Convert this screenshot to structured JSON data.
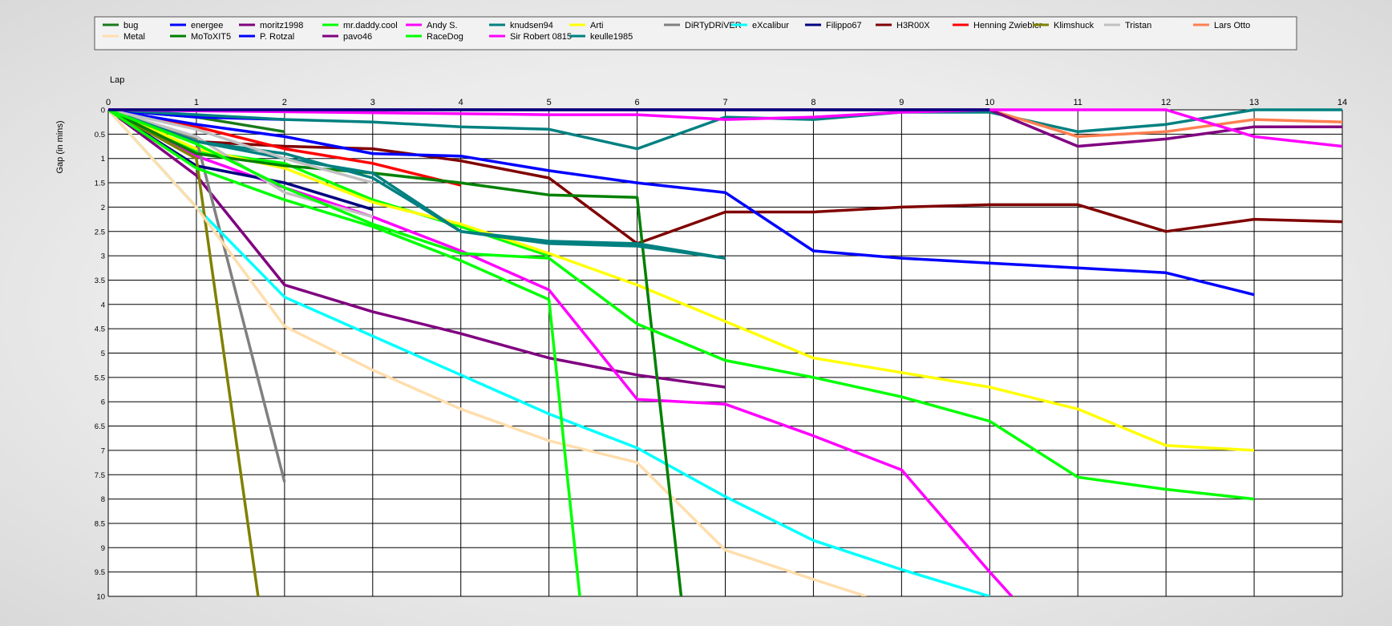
{
  "chart_data": {
    "type": "line",
    "xlabel": "Lap",
    "ylabel": "Gap (in mins)",
    "xlim": [
      0,
      14
    ],
    "ylim": [
      0,
      10
    ],
    "y_inverted": true,
    "grid": true,
    "legend_position": "top",
    "x_ticks": [
      "0",
      "1",
      "2",
      "3",
      "4",
      "5",
      "6",
      "7",
      "8",
      "9",
      "10",
      "11",
      "12",
      "13",
      "14"
    ],
    "y_ticks": [
      "0",
      "0.5",
      "1",
      "1.5",
      "2",
      "2.5",
      "3",
      "3.5",
      "4",
      "4.5",
      "5",
      "5.5",
      "6",
      "6.5",
      "7",
      "7.5",
      "8",
      "8.5",
      "9",
      "9.5",
      "10"
    ],
    "series": [
      {
        "name": "bug",
        "color": "#1a7a1a",
        "points": [
          [
            0,
            0
          ],
          [
            1,
            0.15
          ],
          [
            2,
            0.45
          ]
        ]
      },
      {
        "name": "energee",
        "color": "#0000ff",
        "points": [
          [
            0,
            0
          ],
          [
            1,
            0.15
          ],
          [
            2,
            0.2
          ]
        ]
      },
      {
        "name": "moritz1998",
        "color": "#800080",
        "points": [
          [
            0,
            0
          ],
          [
            1,
            1.35
          ],
          [
            2,
            3.6
          ],
          [
            3,
            4.15
          ],
          [
            4,
            4.6
          ],
          [
            5,
            5.1
          ],
          [
            6,
            5.45
          ],
          [
            7,
            5.7
          ]
        ]
      },
      {
        "name": "mr.daddy.cool",
        "color": "#00ff00",
        "points": [
          [
            0,
            0
          ],
          [
            1,
            0.85
          ],
          [
            2,
            1.1
          ],
          [
            3,
            1.85
          ],
          [
            4,
            2.4
          ],
          [
            5,
            3.0
          ]
        ]
      },
      {
        "name": "Andy S.",
        "color": "#ff00ff",
        "points": [
          [
            0,
            0
          ],
          [
            1,
            0.95
          ],
          [
            2,
            1.6
          ],
          [
            3,
            2.2
          ],
          [
            4,
            2.9
          ],
          [
            5,
            3.7
          ],
          [
            6,
            5.95
          ],
          [
            7,
            6.05
          ],
          [
            8,
            6.7
          ],
          [
            9,
            7.4
          ],
          [
            10,
            9.5
          ],
          [
            10.25,
            10
          ]
        ]
      },
      {
        "name": "knudsen94",
        "color": "#008080",
        "points": [
          [
            0,
            0
          ],
          [
            1,
            0.1
          ],
          [
            2,
            0.2
          ],
          [
            3,
            0.25
          ],
          [
            4,
            0.35
          ],
          [
            5,
            0.4
          ],
          [
            6,
            0.8
          ],
          [
            7,
            0.15
          ],
          [
            8,
            0.2
          ],
          [
            9,
            0.05
          ],
          [
            10,
            0.05
          ],
          [
            11,
            0.45
          ],
          [
            12,
            0.3
          ],
          [
            13,
            0.0
          ],
          [
            14,
            0.0
          ]
        ]
      },
      {
        "name": "Arti",
        "color": "#ffff00",
        "points": [
          [
            0,
            0
          ],
          [
            1,
            0.8
          ],
          [
            2,
            1.2
          ],
          [
            3,
            1.9
          ],
          [
            4,
            2.35
          ],
          [
            5,
            2.95
          ],
          [
            6,
            3.6
          ],
          [
            7,
            4.35
          ],
          [
            8,
            5.1
          ],
          [
            9,
            5.4
          ],
          [
            10,
            5.7
          ],
          [
            11,
            6.15
          ],
          [
            12,
            6.9
          ],
          [
            13,
            7.0
          ]
        ]
      },
      {
        "name": "DiRTyDRiVER",
        "color": "#808080",
        "points": [
          [
            0,
            0
          ],
          [
            1,
            0.6
          ],
          [
            2,
            7.65
          ]
        ]
      },
      {
        "name": "eXcalibur",
        "color": "#00ffff",
        "points": [
          [
            0,
            0
          ],
          [
            1,
            2.0
          ],
          [
            2,
            3.85
          ],
          [
            3,
            4.65
          ],
          [
            4,
            5.45
          ],
          [
            5,
            6.25
          ],
          [
            6,
            6.95
          ],
          [
            7,
            7.95
          ],
          [
            8,
            8.85
          ],
          [
            9,
            9.45
          ],
          [
            10,
            10
          ]
        ]
      },
      {
        "name": "Filippo67",
        "color": "#000080",
        "points": [
          [
            0,
            0
          ],
          [
            1,
            1.15
          ],
          [
            2,
            1.5
          ],
          [
            3,
            2.05
          ]
        ]
      },
      {
        "name": "H3R00X",
        "color": "#800000",
        "points": [
          [
            0,
            0
          ],
          [
            1,
            0.65
          ],
          [
            2,
            0.75
          ],
          [
            3,
            0.8
          ],
          [
            4,
            1.05
          ],
          [
            5,
            1.4
          ],
          [
            6,
            2.75
          ],
          [
            7,
            2.1
          ],
          [
            8,
            2.1
          ],
          [
            9,
            2.0
          ],
          [
            10,
            1.95
          ],
          [
            11,
            1.95
          ],
          [
            12,
            2.5
          ],
          [
            13,
            2.25
          ],
          [
            14,
            2.3
          ]
        ]
      },
      {
        "name": "Henning Zwiebler",
        "color": "#ff0000",
        "points": [
          [
            0,
            0
          ],
          [
            1,
            0.35
          ],
          [
            2,
            0.8
          ],
          [
            3,
            1.1
          ],
          [
            4,
            1.55
          ]
        ]
      },
      {
        "name": "Klimshuck",
        "color": "#808000",
        "points": [
          [
            0,
            0
          ],
          [
            1,
            1.0
          ],
          [
            1.7,
            10
          ]
        ]
      },
      {
        "name": "Tristan",
        "color": "#c0c0c0",
        "points": [
          [
            0,
            0
          ],
          [
            1,
            0.55
          ],
          [
            2,
            1.7
          ],
          [
            3,
            2.2
          ]
        ]
      },
      {
        "name": "Lars Otto",
        "color": "#ff7f50",
        "points": [
          [
            0,
            0
          ],
          [
            10,
            0.0
          ],
          [
            11,
            0.55
          ],
          [
            12,
            0.45
          ],
          [
            13,
            0.2
          ],
          [
            14,
            0.25
          ]
        ]
      },
      {
        "name": "Metal",
        "color": "#ffdead",
        "points": [
          [
            0,
            0
          ],
          [
            1,
            2.0
          ],
          [
            2,
            4.45
          ],
          [
            3,
            5.35
          ],
          [
            4,
            6.15
          ],
          [
            5,
            6.8
          ],
          [
            6,
            7.25
          ],
          [
            7,
            9.05
          ],
          [
            8,
            9.65
          ],
          [
            8.6,
            10
          ]
        ]
      },
      {
        "name": "MoToXIT5",
        "color": "#008000",
        "points": [
          [
            0,
            0
          ],
          [
            1,
            0.9
          ],
          [
            2,
            1.15
          ],
          [
            3,
            1.3
          ],
          [
            4,
            1.5
          ],
          [
            5,
            1.75
          ],
          [
            6,
            1.8
          ],
          [
            6.5,
            10
          ]
        ]
      },
      {
        "name": "P. Rotzal",
        "color": "#0000ff",
        "points": [
          [
            0,
            0
          ],
          [
            1,
            0.3
          ],
          [
            2,
            0.55
          ],
          [
            3,
            0.9
          ],
          [
            4,
            0.95
          ],
          [
            5,
            1.25
          ],
          [
            6,
            1.5
          ],
          [
            7,
            1.7
          ],
          [
            8,
            2.9
          ],
          [
            9,
            3.05
          ],
          [
            10,
            3.15
          ],
          [
            11,
            3.25
          ],
          [
            12,
            3.35
          ],
          [
            13,
            3.8
          ]
        ]
      },
      {
        "name": "pavo46",
        "color": "#800080",
        "points": [
          [
            0,
            0
          ],
          [
            10,
            0.0
          ],
          [
            11,
            0.75
          ],
          [
            12,
            0.6
          ],
          [
            13,
            0.35
          ],
          [
            14,
            0.35
          ]
        ]
      },
      {
        "name": "RaceDog",
        "color": "#00ff00",
        "points": [
          [
            0,
            0
          ],
          [
            1,
            1.2
          ],
          [
            2,
            1.85
          ],
          [
            3,
            2.4
          ],
          [
            4,
            3.1
          ],
          [
            5,
            3.9
          ],
          [
            5.35,
            10
          ]
        ]
      },
      {
        "name": "Sir Robert 0815",
        "color": "#ff00ff",
        "points": [
          [
            0,
            0
          ],
          [
            5,
            0.1
          ],
          [
            6,
            0.1
          ],
          [
            7,
            0.2
          ],
          [
            8,
            0.15
          ],
          [
            9,
            0.05
          ],
          [
            10,
            0.0
          ],
          [
            11,
            0.0
          ],
          [
            12,
            0.0
          ],
          [
            13,
            0.55
          ],
          [
            14,
            0.75
          ]
        ]
      },
      {
        "name": "keulle1985",
        "color": "#008080",
        "points": [
          [
            0,
            0
          ],
          [
            1,
            0.65
          ],
          [
            2,
            1.0
          ],
          [
            3,
            1.3
          ],
          [
            4,
            2.5
          ],
          [
            5,
            2.75
          ],
          [
            6,
            2.8
          ],
          [
            7,
            3.05
          ]
        ]
      },
      {
        "name": "knudsen94",
        "color": "#008080",
        "points": [
          [
            0,
            0
          ],
          [
            1,
            0.65
          ],
          [
            2,
            0.9
          ],
          [
            3,
            1.4
          ],
          [
            4,
            2.5
          ],
          [
            5,
            2.7
          ],
          [
            6,
            2.75
          ],
          [
            7,
            3.05
          ]
        ]
      },
      {
        "name": "Tristan",
        "color": "#c0c0c0",
        "points": [
          [
            0,
            0
          ],
          [
            1,
            0.4
          ],
          [
            2,
            1.0
          ],
          [
            3,
            1.5
          ]
        ]
      },
      {
        "name": "mr.daddy.cool",
        "color": "#00ff00",
        "points": [
          [
            0,
            0
          ],
          [
            1,
            0.7
          ],
          [
            2,
            1.6
          ],
          [
            3,
            2.35
          ],
          [
            4,
            2.95
          ],
          [
            5,
            3.05
          ],
          [
            6,
            4.4
          ],
          [
            7,
            5.15
          ],
          [
            8,
            5.5
          ],
          [
            9,
            5.9
          ],
          [
            10,
            6.4
          ],
          [
            11,
            7.55
          ],
          [
            12,
            7.8
          ],
          [
            13,
            8.0
          ]
        ]
      },
      {
        "name": "Filippo67",
        "color": "#000080",
        "points": [
          [
            0,
            0
          ],
          [
            1,
            0.0
          ],
          [
            2,
            0.0
          ],
          [
            3,
            0.0
          ],
          [
            4,
            0.0
          ],
          [
            5,
            0.0
          ],
          [
            6,
            0.0
          ],
          [
            7,
            0.0
          ],
          [
            8,
            0.0
          ],
          [
            9,
            0.0
          ],
          [
            10,
            0.0
          ]
        ]
      }
    ]
  }
}
